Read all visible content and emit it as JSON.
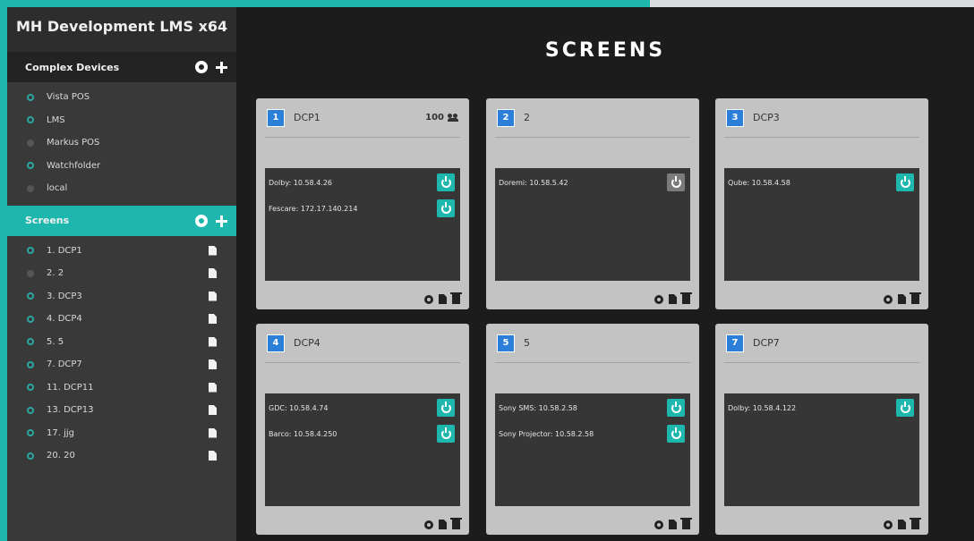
{
  "app_title": "MH Development LMS x64",
  "sidebar": {
    "complex_devices_label": "Complex Devices",
    "devices": [
      {
        "label": "Vista POS",
        "status": "on"
      },
      {
        "label": "LMS",
        "status": "on"
      },
      {
        "label": "Markus POS",
        "status": "off"
      },
      {
        "label": "Watchfolder",
        "status": "on"
      },
      {
        "label": "local",
        "status": "off"
      }
    ],
    "screens_label": "Screens",
    "screens": [
      {
        "label": "1. DCP1",
        "status": "on"
      },
      {
        "label": "2. 2",
        "status": "off"
      },
      {
        "label": "3. DCP3",
        "status": "on"
      },
      {
        "label": "4. DCP4",
        "status": "on"
      },
      {
        "label": "5. 5",
        "status": "on"
      },
      {
        "label": "7. DCP7",
        "status": "on"
      },
      {
        "label": "11. DCP11",
        "status": "on"
      },
      {
        "label": "13. DCP13",
        "status": "on"
      },
      {
        "label": "17. jjg",
        "status": "on"
      },
      {
        "label": "20. 20",
        "status": "on"
      }
    ]
  },
  "main": {
    "title": "SCREENS",
    "cards": [
      {
        "number": "1",
        "name": "DCP1",
        "count": "100",
        "devices": [
          {
            "label": "Dolby: 10.58.4.26",
            "power": "on"
          },
          {
            "label": "Fescare: 172.17.140.214",
            "power": "on"
          }
        ]
      },
      {
        "number": "2",
        "name": "2",
        "count": "",
        "devices": [
          {
            "label": "Doremi: 10.58.5.42",
            "power": "off"
          }
        ]
      },
      {
        "number": "3",
        "name": "DCP3",
        "count": "",
        "devices": [
          {
            "label": "Qube: 10.58.4.58",
            "power": "on"
          }
        ]
      },
      {
        "number": "4",
        "name": "DCP4",
        "count": "",
        "devices": [
          {
            "label": "GDC: 10.58.4.74",
            "power": "on"
          },
          {
            "label": "Barco: 10.58.4.250",
            "power": "on"
          }
        ]
      },
      {
        "number": "5",
        "name": "5",
        "count": "",
        "devices": [
          {
            "label": "Sony SMS: 10.58.2.58",
            "power": "on"
          },
          {
            "label": "Sony Projector: 10.58.2.58",
            "power": "on"
          }
        ]
      },
      {
        "number": "7",
        "name": "DCP7",
        "count": "",
        "devices": [
          {
            "label": "Dolby: 10.58.4.122",
            "power": "on"
          }
        ]
      }
    ]
  }
}
